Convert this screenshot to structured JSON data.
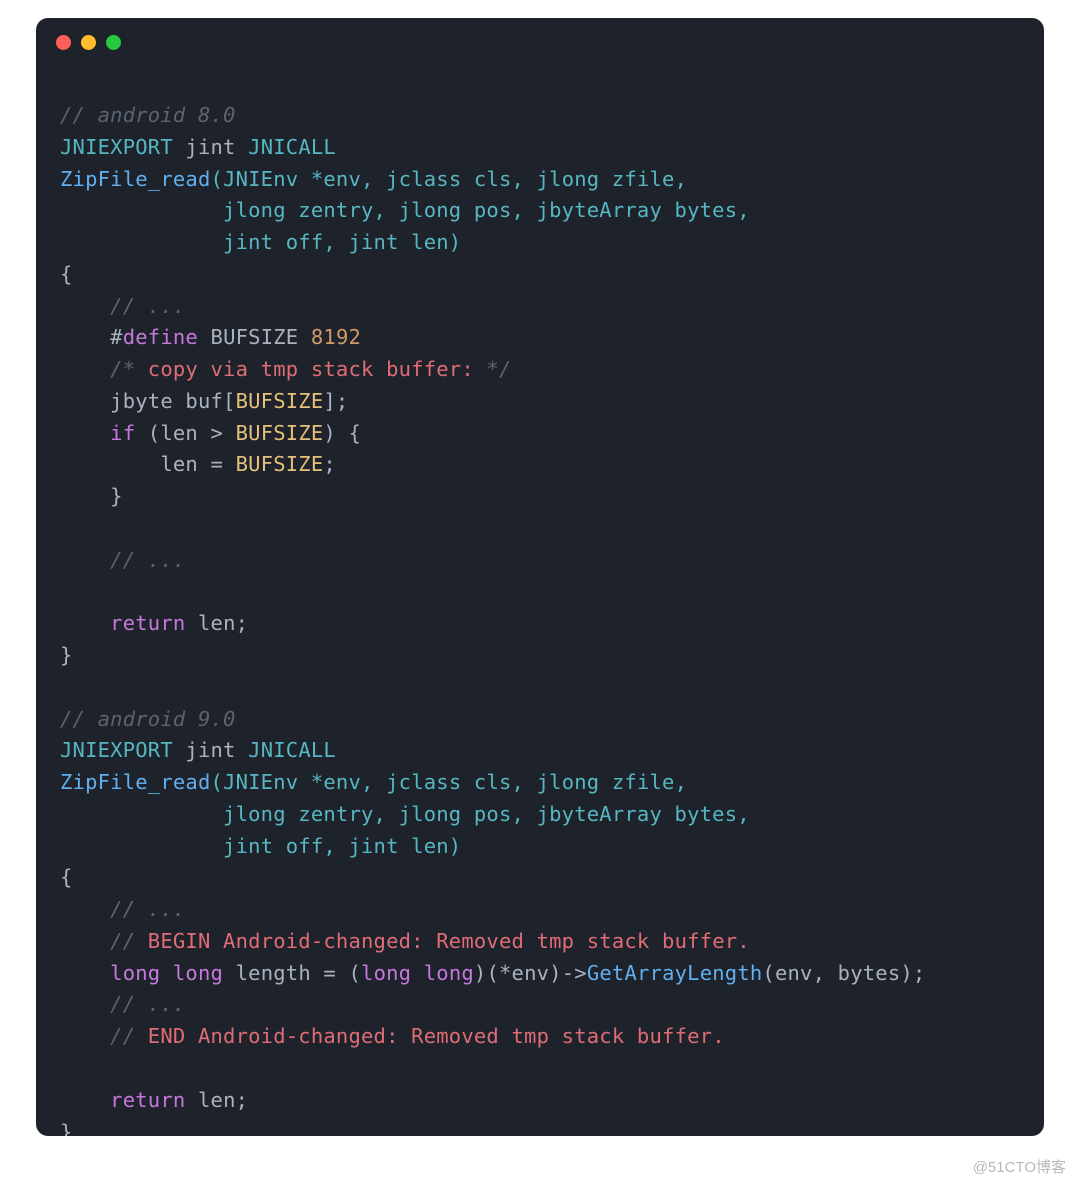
{
  "watermark": "@51CTO博客",
  "code": {
    "l1a": "// android 8.0",
    "l2a": "JNIEXPORT",
    "l2b": " jint ",
    "l2c": "JNICALL",
    "l3a": "ZipFile_read",
    "l3b": "(JNIEnv *env, jclass cls, jlong zfile,",
    "l4": "             jlong zentry, jlong pos, jbyteArray bytes,",
    "l5": "             jint off, jint len)",
    "l6": "{",
    "l7": "    // ...",
    "l8a": "    #",
    "l8b": "define",
    "l8c": " BUFSIZE ",
    "l8d": "8192",
    "l9a": "    /* ",
    "l9b": "copy via tmp stack buffer:",
    "l9c": " */",
    "l10a": "    jbyte buf[",
    "l10b": "BUFSIZE",
    "l10c": "];",
    "l11a": "    ",
    "l11b": "if",
    "l11c": " (len > ",
    "l11d": "BUFSIZE",
    "l11e": ") {",
    "l12a": "        len = ",
    "l12b": "BUFSIZE",
    "l12c": ";",
    "l13": "    }",
    "l14": "",
    "l15": "    // ...",
    "l16": "",
    "l17a": "    ",
    "l17b": "return",
    "l17c": " len;",
    "l18": "}",
    "l19": "",
    "l20": "// android 9.0",
    "l21a": "JNIEXPORT",
    "l21b": " jint ",
    "l21c": "JNICALL",
    "l22a": "ZipFile_read",
    "l22b": "(JNIEnv *env, jclass cls, jlong zfile,",
    "l23": "             jlong zentry, jlong pos, jbyteArray bytes,",
    "l24": "             jint off, jint len)",
    "l25": "{",
    "l26": "    // ...",
    "l27a": "    // ",
    "l27b": "BEGIN Android-changed: Removed tmp stack buffer.",
    "l28a": "    ",
    "l28b": "long",
    "l28c": " ",
    "l28d": "long",
    "l28e": " length = (",
    "l28f": "long",
    "l28g": " ",
    "l28h": "long",
    "l28i": ")(*env)->",
    "l28j": "GetArrayLength",
    "l28k": "(env, bytes);",
    "l29": "    // ...",
    "l30a": "    // ",
    "l30b": "END Android-changed: Removed tmp stack buffer.",
    "l31": "",
    "l32a": "    ",
    "l32b": "return",
    "l32c": " len;",
    "l33": "}"
  }
}
